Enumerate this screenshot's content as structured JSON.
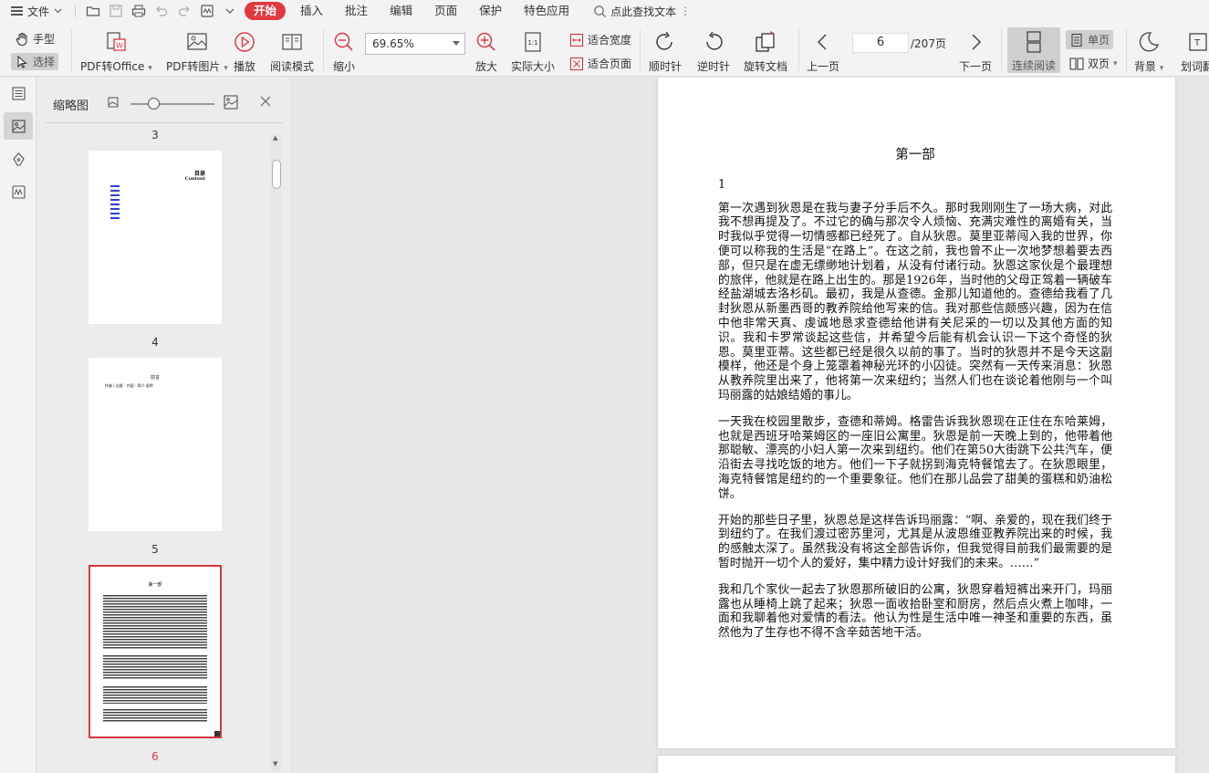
{
  "menu": {
    "file_label": "文件",
    "tabs": [
      {
        "label": "开始",
        "active": true
      },
      {
        "label": "插入",
        "active": false
      },
      {
        "label": "批注",
        "active": false
      },
      {
        "label": "编辑",
        "active": false
      },
      {
        "label": "页面",
        "active": false
      },
      {
        "label": "保护",
        "active": false
      },
      {
        "label": "特色应用",
        "active": false
      }
    ],
    "search_label": "点此查找文本"
  },
  "toolbar": {
    "hand_label": "手型",
    "select_label": "选择",
    "pdf_to_office": "PDF转Office",
    "pdf_to_image": "PDF转图片",
    "play": "播放",
    "read_mode": "阅读模式",
    "zoom_out": "缩小",
    "zoom_value": "69.65%",
    "zoom_in": "放大",
    "actual_size": "实际大小",
    "fit_width": "适合宽度",
    "fit_page": "适合页面",
    "rotate_cw": "顺时针",
    "rotate_ccw": "逆时针",
    "rotate_doc": "旋转文档",
    "prev_page": "上一页",
    "current_page": "6",
    "total_pages": "/207页",
    "next_page": "下一页",
    "continuous": "连续阅读",
    "single_page": "单页",
    "double_page": "双页",
    "background": "背景",
    "word_tool": "划词翻"
  },
  "thumbnails": {
    "title": "缩略图",
    "pages": [
      {
        "num": "3",
        "active": false
      },
      {
        "num": "4",
        "active": false
      },
      {
        "num": "5",
        "active": false
      },
      {
        "num": "6",
        "active": true
      }
    ],
    "toc_title": "目录",
    "toc_subtitle": "Content",
    "preface_title": "前言",
    "preface_line": "作者 | 出版 · 内容 · 简介 说明",
    "part_title": "第一部"
  },
  "document": {
    "part_title": "第一部",
    "chapter_num": "1",
    "paragraphs": [
      "第一次遇到狄恩是在我与妻子分手后不久。那时我刚刚生了一场大病，对此我不想再提及了。不过它的确与那次令人烦恼、充满灾难性的离婚有关，当时我似乎觉得一切情感都已经死了。自从狄恩。莫里亚蒂闯入我的世界，你便可以称我的生活是“在路上”。在这之前，我也曾不止一次地梦想着要去西部，但只是在虚无缥缈地计划着，从没有付诸行动。狄恩这家伙是个最理想的旅伴，他就是在路上出生的。那是1926年，当时他的父母正驾着一辆破车经盐湖城去洛杉矶。最初，我是从查德。金那儿知道他的。查德给我看了几封狄恩从新墨西哥的教养院给他写来的信。我对那些信颇感兴趣，因为在信中他非常天真、虔诚地恳求查德给他讲有关尼采的一切以及其他方面的知识。我和卡罗常谈起这些信，并希望今后能有机会认识一下这个奇怪的狄恩。莫里亚蒂。这些都已经是很久以前的事了。当时的狄恩并不是今天这副模样，他还是个身上笼罩着神秘光环的小囚徒。突然有一天传来消息：狄恩从教养院里出来了，他将第一次来纽约；当然人们也在谈论着他刚与一个叫玛丽露的姑娘结婚的事儿。",
      "一天我在校园里散步，查德和蒂姆。格雷告诉我狄恩现在正住在东哈莱姆，也就是西班牙哈莱姆区的一座旧公寓里。狄恩是前一天晚上到的，他带着他那聪敏、漂亮的小妇人第一次来到纽约。他们在第50大街跳下公共汽车，便沿街去寻找吃饭的地方。他们一下子就拐到海克特餐馆去了。在狄恩眼里，海克特餐馆是纽约的一个重要象征。他们在那儿品尝了甜美的蛋糕和奶油松饼。",
      "开始的那些日子里，狄恩总是这样告诉玛丽露：“啊、亲爱的，现在我们终于到纽约了。在我们渡过密苏里河，尤其是从波恩维亚教养院出来的时候，我的感触太深了。虽然我没有将这全部告诉你，但我觉得目前我们最需要的是暂时抛开一切个人的爱好，集中精力设计好我们的未来。……”",
      "我和几个家伙一起去了狄恩那所破旧的公寓，狄恩穿着短裤出来开门，玛丽露也从睡椅上跳了起来；狄恩一面收拾卧室和厨房，然后点火煮上咖啡，一面和我聊着他对爱情的看法。他认为性是生活中唯一神圣和重要的东西，虽然他为了生存也不得不含辛茹苦地干活。"
    ]
  }
}
